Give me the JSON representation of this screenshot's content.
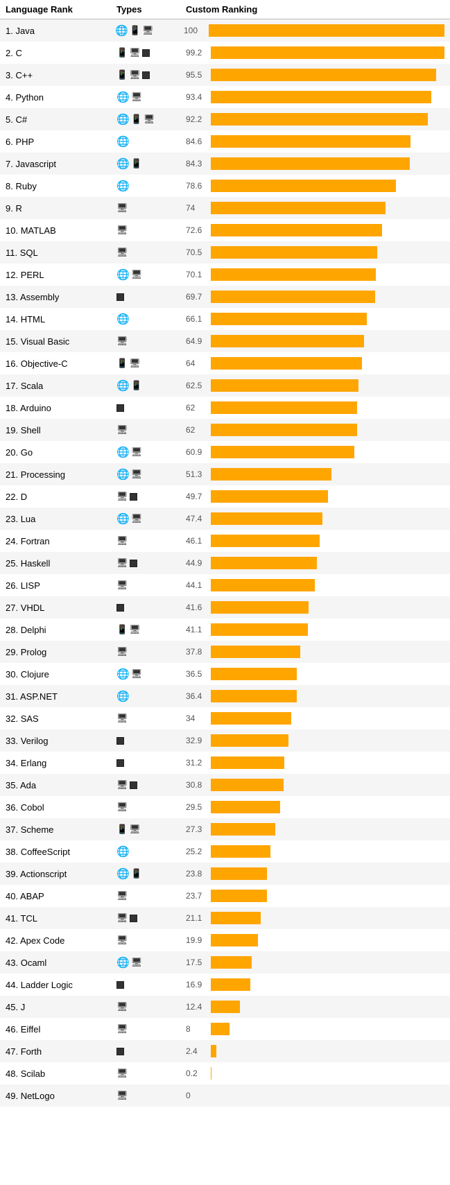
{
  "header": {
    "col_rank": "Language Rank",
    "col_types": "Types",
    "col_ranking": "Custom Ranking"
  },
  "rows": [
    {
      "rank": "1.",
      "name": "Java",
      "types": [
        "web",
        "mobile",
        "desktop"
      ],
      "value": 100.0
    },
    {
      "rank": "2.",
      "name": "C",
      "types": [
        "mobile",
        "desktop",
        "embedded"
      ],
      "value": 99.2
    },
    {
      "rank": "3.",
      "name": "C++",
      "types": [
        "mobile",
        "desktop",
        "embedded"
      ],
      "value": 95.5
    },
    {
      "rank": "4.",
      "name": "Python",
      "types": [
        "web",
        "desktop"
      ],
      "value": 93.4
    },
    {
      "rank": "5.",
      "name": "C#",
      "types": [
        "web",
        "mobile",
        "desktop"
      ],
      "value": 92.2
    },
    {
      "rank": "6.",
      "name": "PHP",
      "types": [
        "web"
      ],
      "value": 84.6
    },
    {
      "rank": "7.",
      "name": "Javascript",
      "types": [
        "web",
        "mobile"
      ],
      "value": 84.3
    },
    {
      "rank": "8.",
      "name": "Ruby",
      "types": [
        "web"
      ],
      "value": 78.6
    },
    {
      "rank": "9.",
      "name": "R",
      "types": [
        "desktop"
      ],
      "value": 74.0
    },
    {
      "rank": "10.",
      "name": "MATLAB",
      "types": [
        "desktop"
      ],
      "value": 72.6
    },
    {
      "rank": "11.",
      "name": "SQL",
      "types": [
        "desktop"
      ],
      "value": 70.5
    },
    {
      "rank": "12.",
      "name": "PERL",
      "types": [
        "web",
        "desktop"
      ],
      "value": 70.1
    },
    {
      "rank": "13.",
      "name": "Assembly",
      "types": [
        "embedded"
      ],
      "value": 69.7
    },
    {
      "rank": "14.",
      "name": "HTML",
      "types": [
        "web"
      ],
      "value": 66.1
    },
    {
      "rank": "15.",
      "name": "Visual Basic",
      "types": [
        "desktop"
      ],
      "value": 64.9
    },
    {
      "rank": "16.",
      "name": "Objective-C",
      "types": [
        "mobile",
        "desktop"
      ],
      "value": 64.0
    },
    {
      "rank": "17.",
      "name": "Scala",
      "types": [
        "web",
        "mobile"
      ],
      "value": 62.5
    },
    {
      "rank": "18.",
      "name": "Arduino",
      "types": [
        "embedded"
      ],
      "value": 62.0
    },
    {
      "rank": "19.",
      "name": "Shell",
      "types": [
        "desktop"
      ],
      "value": 62.0
    },
    {
      "rank": "20.",
      "name": "Go",
      "types": [
        "web",
        "desktop"
      ],
      "value": 60.9
    },
    {
      "rank": "21.",
      "name": "Processing",
      "types": [
        "web",
        "desktop"
      ],
      "value": 51.3
    },
    {
      "rank": "22.",
      "name": "D",
      "types": [
        "desktop",
        "embedded"
      ],
      "value": 49.7
    },
    {
      "rank": "23.",
      "name": "Lua",
      "types": [
        "web",
        "desktop"
      ],
      "value": 47.4
    },
    {
      "rank": "24.",
      "name": "Fortran",
      "types": [
        "desktop"
      ],
      "value": 46.1
    },
    {
      "rank": "25.",
      "name": "Haskell",
      "types": [
        "desktop",
        "embedded"
      ],
      "value": 44.9
    },
    {
      "rank": "26.",
      "name": "LISP",
      "types": [
        "desktop"
      ],
      "value": 44.1
    },
    {
      "rank": "27.",
      "name": "VHDL",
      "types": [
        "embedded"
      ],
      "value": 41.6
    },
    {
      "rank": "28.",
      "name": "Delphi",
      "types": [
        "mobile",
        "desktop"
      ],
      "value": 41.1
    },
    {
      "rank": "29.",
      "name": "Prolog",
      "types": [
        "desktop"
      ],
      "value": 37.8
    },
    {
      "rank": "30.",
      "name": "Clojure",
      "types": [
        "web",
        "desktop"
      ],
      "value": 36.5
    },
    {
      "rank": "31.",
      "name": "ASP.NET",
      "types": [
        "web"
      ],
      "value": 36.4
    },
    {
      "rank": "32.",
      "name": "SAS",
      "types": [
        "desktop"
      ],
      "value": 34.0
    },
    {
      "rank": "33.",
      "name": "Verilog",
      "types": [
        "embedded"
      ],
      "value": 32.9
    },
    {
      "rank": "34.",
      "name": "Erlang",
      "types": [
        "embedded"
      ],
      "value": 31.2
    },
    {
      "rank": "35.",
      "name": "Ada",
      "types": [
        "desktop",
        "embedded"
      ],
      "value": 30.8
    },
    {
      "rank": "36.",
      "name": "Cobol",
      "types": [
        "desktop"
      ],
      "value": 29.5
    },
    {
      "rank": "37.",
      "name": "Scheme",
      "types": [
        "mobile",
        "desktop"
      ],
      "value": 27.3
    },
    {
      "rank": "38.",
      "name": "CoffeeScript",
      "types": [
        "web"
      ],
      "value": 25.2
    },
    {
      "rank": "39.",
      "name": "Actionscript",
      "types": [
        "web",
        "mobile"
      ],
      "value": 23.8
    },
    {
      "rank": "40.",
      "name": "ABAP",
      "types": [
        "desktop"
      ],
      "value": 23.7
    },
    {
      "rank": "41.",
      "name": "TCL",
      "types": [
        "desktop",
        "embedded"
      ],
      "value": 21.1
    },
    {
      "rank": "42.",
      "name": "Apex Code",
      "types": [
        "desktop"
      ],
      "value": 19.9
    },
    {
      "rank": "43.",
      "name": "Ocaml",
      "types": [
        "web",
        "desktop"
      ],
      "value": 17.5
    },
    {
      "rank": "44.",
      "name": "Ladder Logic",
      "types": [
        "embedded"
      ],
      "value": 16.9
    },
    {
      "rank": "45.",
      "name": "J",
      "types": [
        "desktop"
      ],
      "value": 12.4
    },
    {
      "rank": "46.",
      "name": "Eiffel",
      "types": [
        "desktop"
      ],
      "value": 8.0
    },
    {
      "rank": "47.",
      "name": "Forth",
      "types": [
        "embedded"
      ],
      "value": 2.4
    },
    {
      "rank": "48.",
      "name": "Scilab",
      "types": [
        "desktop"
      ],
      "value": 0.2
    },
    {
      "rank": "49.",
      "name": "NetLogo",
      "types": [
        "desktop"
      ],
      "value": 0.0
    }
  ],
  "max_value": 100.0,
  "bar_max_width": 340,
  "accent_color": "#FFA500"
}
